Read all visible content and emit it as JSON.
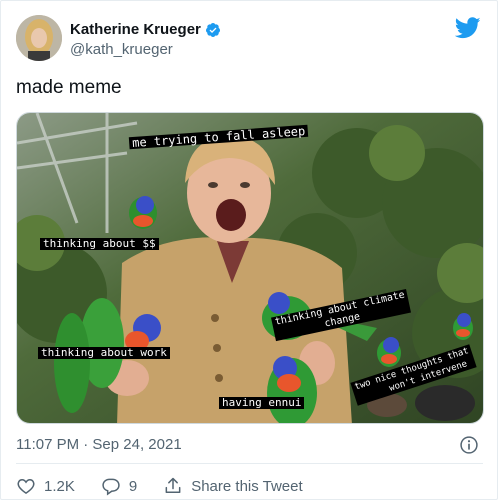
{
  "tweet": {
    "author": {
      "display_name": "Katherine Krueger",
      "handle": "@kath_krueger",
      "verified": true
    },
    "text": "made meme",
    "meme_captions": {
      "top": "me trying to fall asleep",
      "money": "thinking about $$",
      "climate": "thinking about climate\n        change",
      "work": "thinking about work",
      "ennui": "having ennui",
      "nice": "two nice thoughts that\n      won't intervene"
    },
    "timestamp": "11:07 PM · Sep 24, 2021",
    "actions": {
      "likes": "1.2K",
      "replies": "9",
      "share_label": "Share this Tweet"
    }
  },
  "colors": {
    "text": "#0f1419",
    "secondary": "#536471",
    "twitter_blue": "#1d9bf0",
    "divider": "#e6ecf0"
  },
  "icons": [
    "verified-badge-icon",
    "twitter-bird-icon",
    "info-icon",
    "heart-icon",
    "reply-icon",
    "share-icon"
  ]
}
